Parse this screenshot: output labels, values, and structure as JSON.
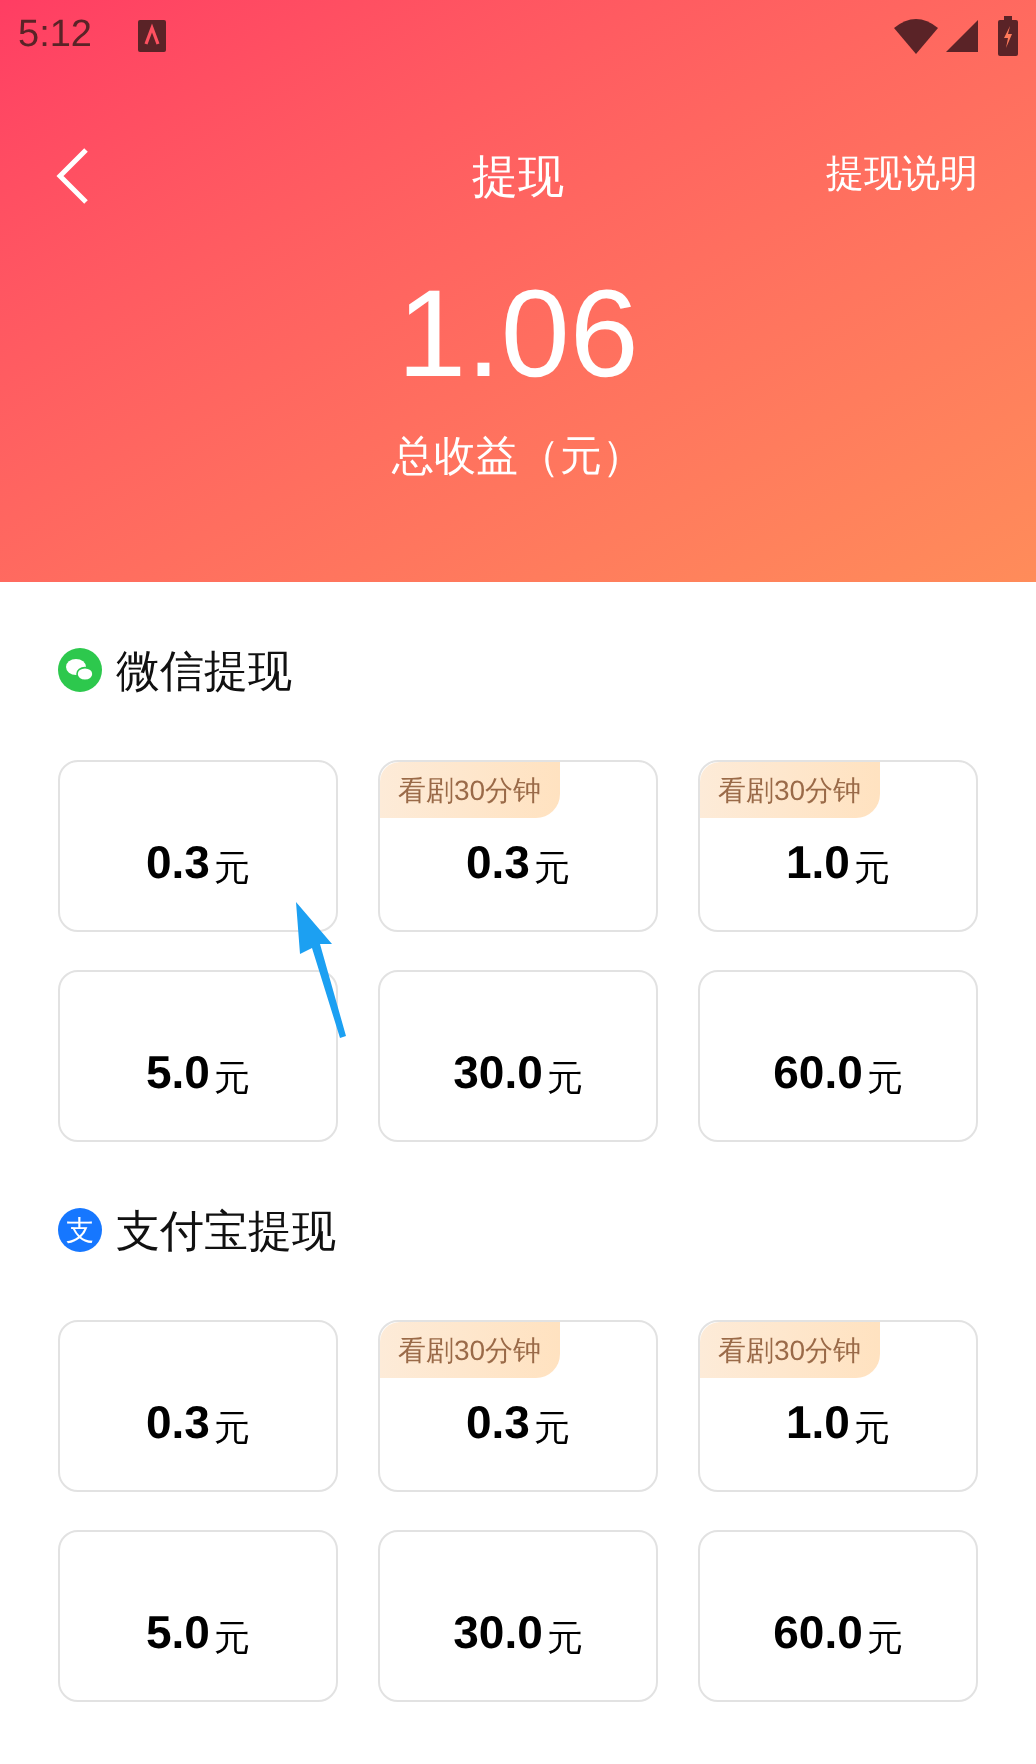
{
  "status_bar": {
    "time": "5:12"
  },
  "header": {
    "title": "提现",
    "link": "提现说明"
  },
  "balance": {
    "amount": "1.06",
    "label": "总收益（元）"
  },
  "sections": [
    {
      "kind": "wechat",
      "title": "微信提现",
      "options": [
        {
          "amount": "0.3",
          "unit": "元"
        },
        {
          "amount": "0.3",
          "unit": "元",
          "badge": "看剧30分钟"
        },
        {
          "amount": "1.0",
          "unit": "元",
          "badge": "看剧30分钟"
        },
        {
          "amount": "5.0",
          "unit": "元"
        },
        {
          "amount": "30.0",
          "unit": "元"
        },
        {
          "amount": "60.0",
          "unit": "元"
        }
      ]
    },
    {
      "kind": "alipay",
      "title": "支付宝提现",
      "icon_text": "支",
      "options": [
        {
          "amount": "0.3",
          "unit": "元"
        },
        {
          "amount": "0.3",
          "unit": "元",
          "badge": "看剧30分钟"
        },
        {
          "amount": "1.0",
          "unit": "元",
          "badge": "看剧30分钟"
        },
        {
          "amount": "5.0",
          "unit": "元"
        },
        {
          "amount": "30.0",
          "unit": "元"
        },
        {
          "amount": "60.0",
          "unit": "元"
        }
      ]
    }
  ]
}
